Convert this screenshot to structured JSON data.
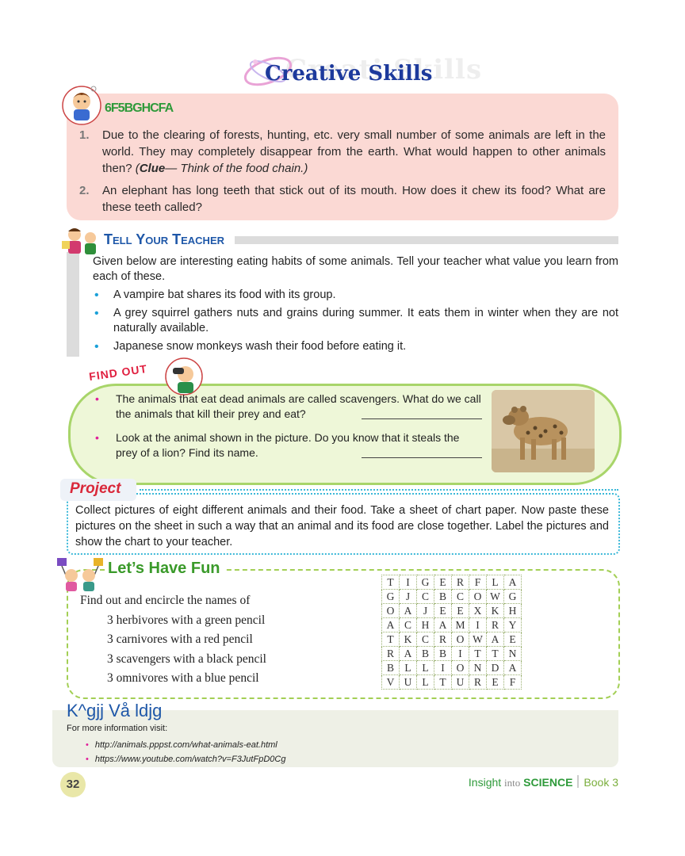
{
  "title": {
    "main": "Creative Skills",
    "ghost": "Creati Skills"
  },
  "hots": {
    "label": "6F5BGHCFA",
    "questions": [
      {
        "num": "1.",
        "text": "Due to the clearing of forests, hunting, etc. very small number of some animals are left in the world. They may completely disappear from the earth. What would happen to other animals then?",
        "clue_label": "Clue",
        "clue_text": "— Think of the food chain.)"
      },
      {
        "num": "2.",
        "text": "An elephant has long teeth that stick out of its mouth. How does it chew its food? What are these teeth called?"
      }
    ]
  },
  "tell_your_teacher": {
    "title": "Tell Your Teacher",
    "intro": "Given below are interesting eating habits of some animals. Tell your teacher what value you learn from each of these.",
    "items": [
      "A vampire bat shares its food with its group.",
      "A grey squirrel gathers nuts and grains during summer. It eats them in winter when they are not naturally available.",
      "Japanese snow monkeys wash their food before eating it."
    ]
  },
  "find_out": {
    "label": "FIND OUT",
    "items": [
      "The animals that eat dead animals are called scavengers. What do we call the animals that kill their prey and eat?",
      "Look at the animal shown in the picture. Do you know that it steals the prey of a lion? Find its name."
    ]
  },
  "project": {
    "label": "Project",
    "text": "Collect pictures of eight different animals and their food. Take a sheet of chart paper. Now paste these pictures on the sheet in such a way that an animal and its food are close together. Label the pictures and show the chart to your teacher."
  },
  "fun": {
    "title": "Let’s Have Fun",
    "instruction": "Find out and encircle the names of",
    "tasks": [
      "3 herbivores with a green pencil",
      "3 carnivores with a red pencil",
      "3 scavengers with a black pencil",
      "3 omnivores with a blue pencil"
    ],
    "grid": [
      [
        "T",
        "I",
        "G",
        "E",
        "R",
        "F",
        "L",
        "A"
      ],
      [
        "G",
        "J",
        "C",
        "B",
        "C",
        "O",
        "W",
        "G"
      ],
      [
        "O",
        "A",
        "J",
        "E",
        "E",
        "X",
        "K",
        "H"
      ],
      [
        "A",
        "C",
        "H",
        "A",
        "M",
        "I",
        "R",
        "Y"
      ],
      [
        "T",
        "K",
        "C",
        "R",
        "O",
        "W",
        "A",
        "E"
      ],
      [
        "R",
        "A",
        "B",
        "B",
        "I",
        "T",
        "T",
        "N"
      ],
      [
        "B",
        "L",
        "L",
        "I",
        "O",
        "N",
        "D",
        "A"
      ],
      [
        "V",
        "U",
        "L",
        "T",
        "U",
        "R",
        "E",
        "F"
      ]
    ]
  },
  "web": {
    "title": "K^gjj Vå ldjg",
    "info": "For more information visit:",
    "links": [
      "http://animals.pppst.com/what-animals-eat.html",
      "https://www.youtube.com/watch?v=F3JutFpD0Cg"
    ]
  },
  "footer": {
    "page_number": "32",
    "insight": "Insight",
    "into": "into",
    "science": "SCIENCE",
    "book": "Book 3"
  },
  "colors": {
    "hots_bg": "#fbd9d4",
    "find_out_border": "#a8d56a",
    "project_border": "#3bb8d8",
    "fun_border": "#a3cf55",
    "title_blue": "#1d3a9c"
  }
}
